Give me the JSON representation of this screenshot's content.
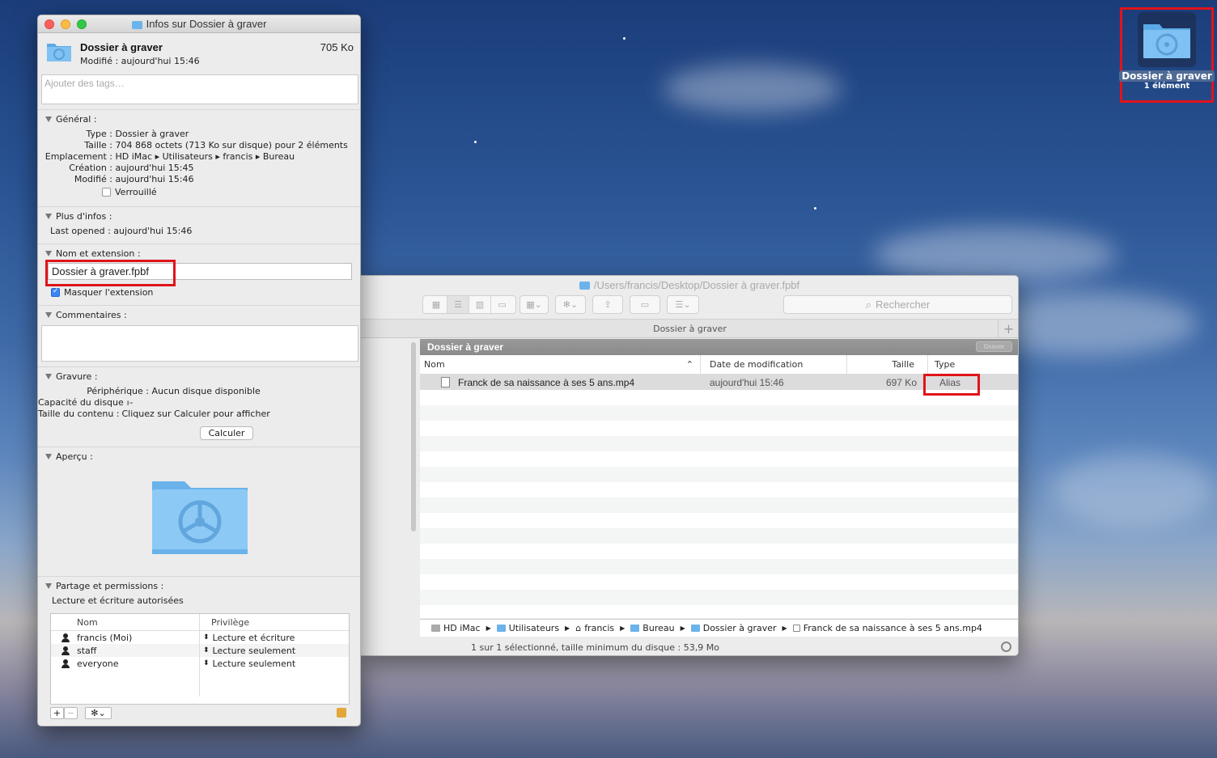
{
  "desktop": {
    "icon_label": "Dossier à graver",
    "icon_sublabel": "1 élément"
  },
  "info_window": {
    "title": "Infos sur Dossier à graver",
    "name": "Dossier à graver",
    "size": "705 Ko",
    "modified_line": "Modifié : aujourd'hui 15:46",
    "tags_placeholder": "Ajouter des tags…",
    "general": {
      "heading": "Général :",
      "type_k": "Type :",
      "type_v": "Dossier à graver",
      "size_k": "Taille :",
      "size_v": "704 868 octets (713 Ko sur disque) pour 2 éléments",
      "loc_k": "Emplacement :",
      "loc_v": "HD iMac ▸ Utilisateurs ▸ francis ▸ Bureau",
      "created_k": "Création :",
      "created_v": "aujourd'hui 15:45",
      "modified_k": "Modifié :",
      "modified_v": "aujourd'hui 15:46",
      "locked_label": "Verrouillé"
    },
    "more_info": {
      "heading": "Plus d'infos :",
      "last_opened": "Last opened : aujourd'hui 15:46"
    },
    "name_ext": {
      "heading": "Nom et extension :",
      "value": "Dossier à graver.fpbf",
      "hide_ext_label": "Masquer l'extension"
    },
    "comments": {
      "heading": "Commentaires :"
    },
    "burning": {
      "heading": "Gravure :",
      "device_k": "Périphérique :",
      "device_v": "Aucun disque disponible",
      "capacity_k": "Capacité du disque :",
      "capacity_v": "--",
      "content_k": "Taille du contenu :",
      "content_v": "Cliquez sur Calculer pour afficher",
      "calc_button": "Calculer"
    },
    "preview": {
      "heading": "Aperçu :"
    },
    "sharing": {
      "heading": "Partage et permissions :",
      "summary": "Lecture et écriture autorisées",
      "col_name": "Nom",
      "col_priv": "Privilège",
      "rows": [
        {
          "name": "francis (Moi)",
          "priv": "Lecture et écriture"
        },
        {
          "name": "staff",
          "priv": "Lecture seulement"
        },
        {
          "name": "everyone",
          "priv": "Lecture seulement"
        }
      ]
    }
  },
  "finder": {
    "title": "/Users/francis/Desktop/Dossier à graver.fpbf",
    "search_placeholder": "Rechercher",
    "tab": "Dossier à graver",
    "folder_header": "Dossier à graver",
    "header_button": "Graver",
    "columns": {
      "name": "Nom",
      "date": "Date de modification",
      "size": "Taille",
      "type": "Type"
    },
    "files": [
      {
        "name": "Franck de sa naissance à ses 5 ans.mp4",
        "date": "aujourd'hui 15:46",
        "size": "697 Ko",
        "type": "Alias"
      }
    ],
    "path": [
      "HD iMac",
      "Utilisateurs",
      "francis",
      "Bureau",
      "Dossier à graver",
      "Franck de sa naissance à ses 5 ans.mp4"
    ],
    "status": "1 sur 1 sélectionné, taille minimum du disque : 53,9 Mo"
  }
}
